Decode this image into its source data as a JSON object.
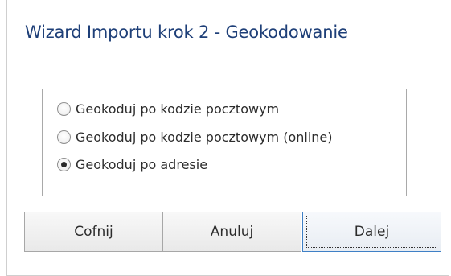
{
  "window": {
    "title": "Wizard Importu krok 2 - Geokodowanie"
  },
  "options": [
    {
      "label": "Geokoduj po kodzie pocztowym",
      "checked": false
    },
    {
      "label": "Geokoduj po kodzie pocztowym (online)",
      "checked": false
    },
    {
      "label": "Geokoduj po adresie",
      "checked": true
    }
  ],
  "buttons": {
    "back_label": "Cofnij",
    "cancel_label": "Anuluj",
    "next_label": "Dalej"
  },
  "colors": {
    "title": "#1e3f78",
    "focus_border": "#3f80c6"
  }
}
